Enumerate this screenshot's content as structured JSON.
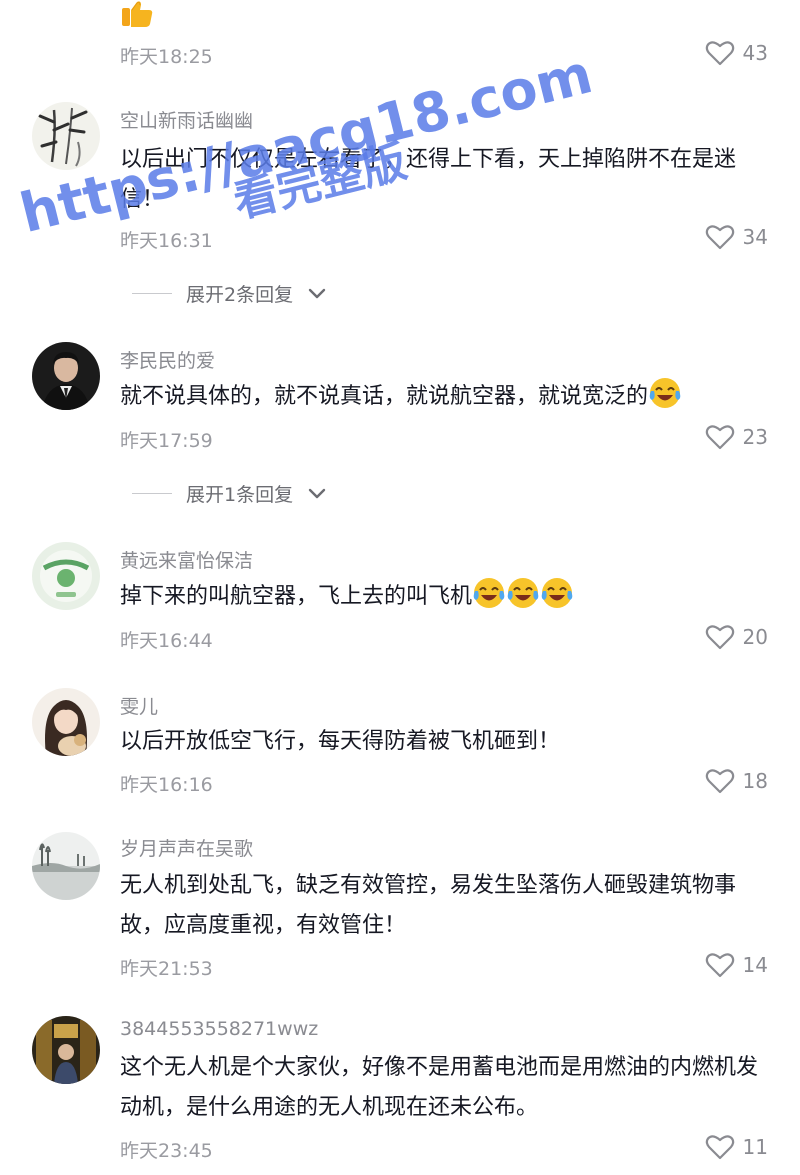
{
  "colors": {
    "text_primary": "#161823",
    "text_secondary": "#8a8b91",
    "watermark": "#5a7ce8"
  },
  "first_item": {
    "time": "昨天18:25",
    "likes": "43",
    "emoji": "thumbs-up-emoji"
  },
  "comments": [
    {
      "username": "空山新雨话幽幽",
      "text": "以后出门不仅仅是左右看了，还得上下看，天上掉陷阱不在是迷信！",
      "time": "昨天16:31",
      "likes": "34",
      "replies": "展开2条回复"
    },
    {
      "username": "李民民的爱",
      "text": "就不说具体的，就不说真话，就说航空器，就说宽泛的",
      "emoji": "tears-of-joy-emoji",
      "time": "昨天17:59",
      "likes": "23",
      "replies": "展开1条回复"
    },
    {
      "username": "黄远来富怡保洁",
      "text": "掉下来的叫航空器，飞上去的叫飞机",
      "emoji": "tears-of-joy-emoji",
      "time": "昨天16:44",
      "likes": "20"
    },
    {
      "username": "雯儿",
      "text": "以后开放低空飞行，每天得防着被飞机砸到！",
      "time": "昨天16:16",
      "likes": "18"
    },
    {
      "username": "岁月声声在吴歌",
      "text": "无人机到处乱飞，缺乏有效管控，易发生坠落伤人砸毁建筑物事故，应高度重视，有效管住！",
      "time": "昨天21:53",
      "likes": "14"
    },
    {
      "username": "3844553558271wwz",
      "text": "这个无人机是个大家伙，好像不是用蓄电池而是用燃油的内燃机发动机，是什么用途的无人机现在还未公布。",
      "time": "昨天23:45",
      "likes": "11"
    }
  ],
  "watermark": {
    "url": "https://aacg18.com",
    "caption": "看完整版"
  }
}
